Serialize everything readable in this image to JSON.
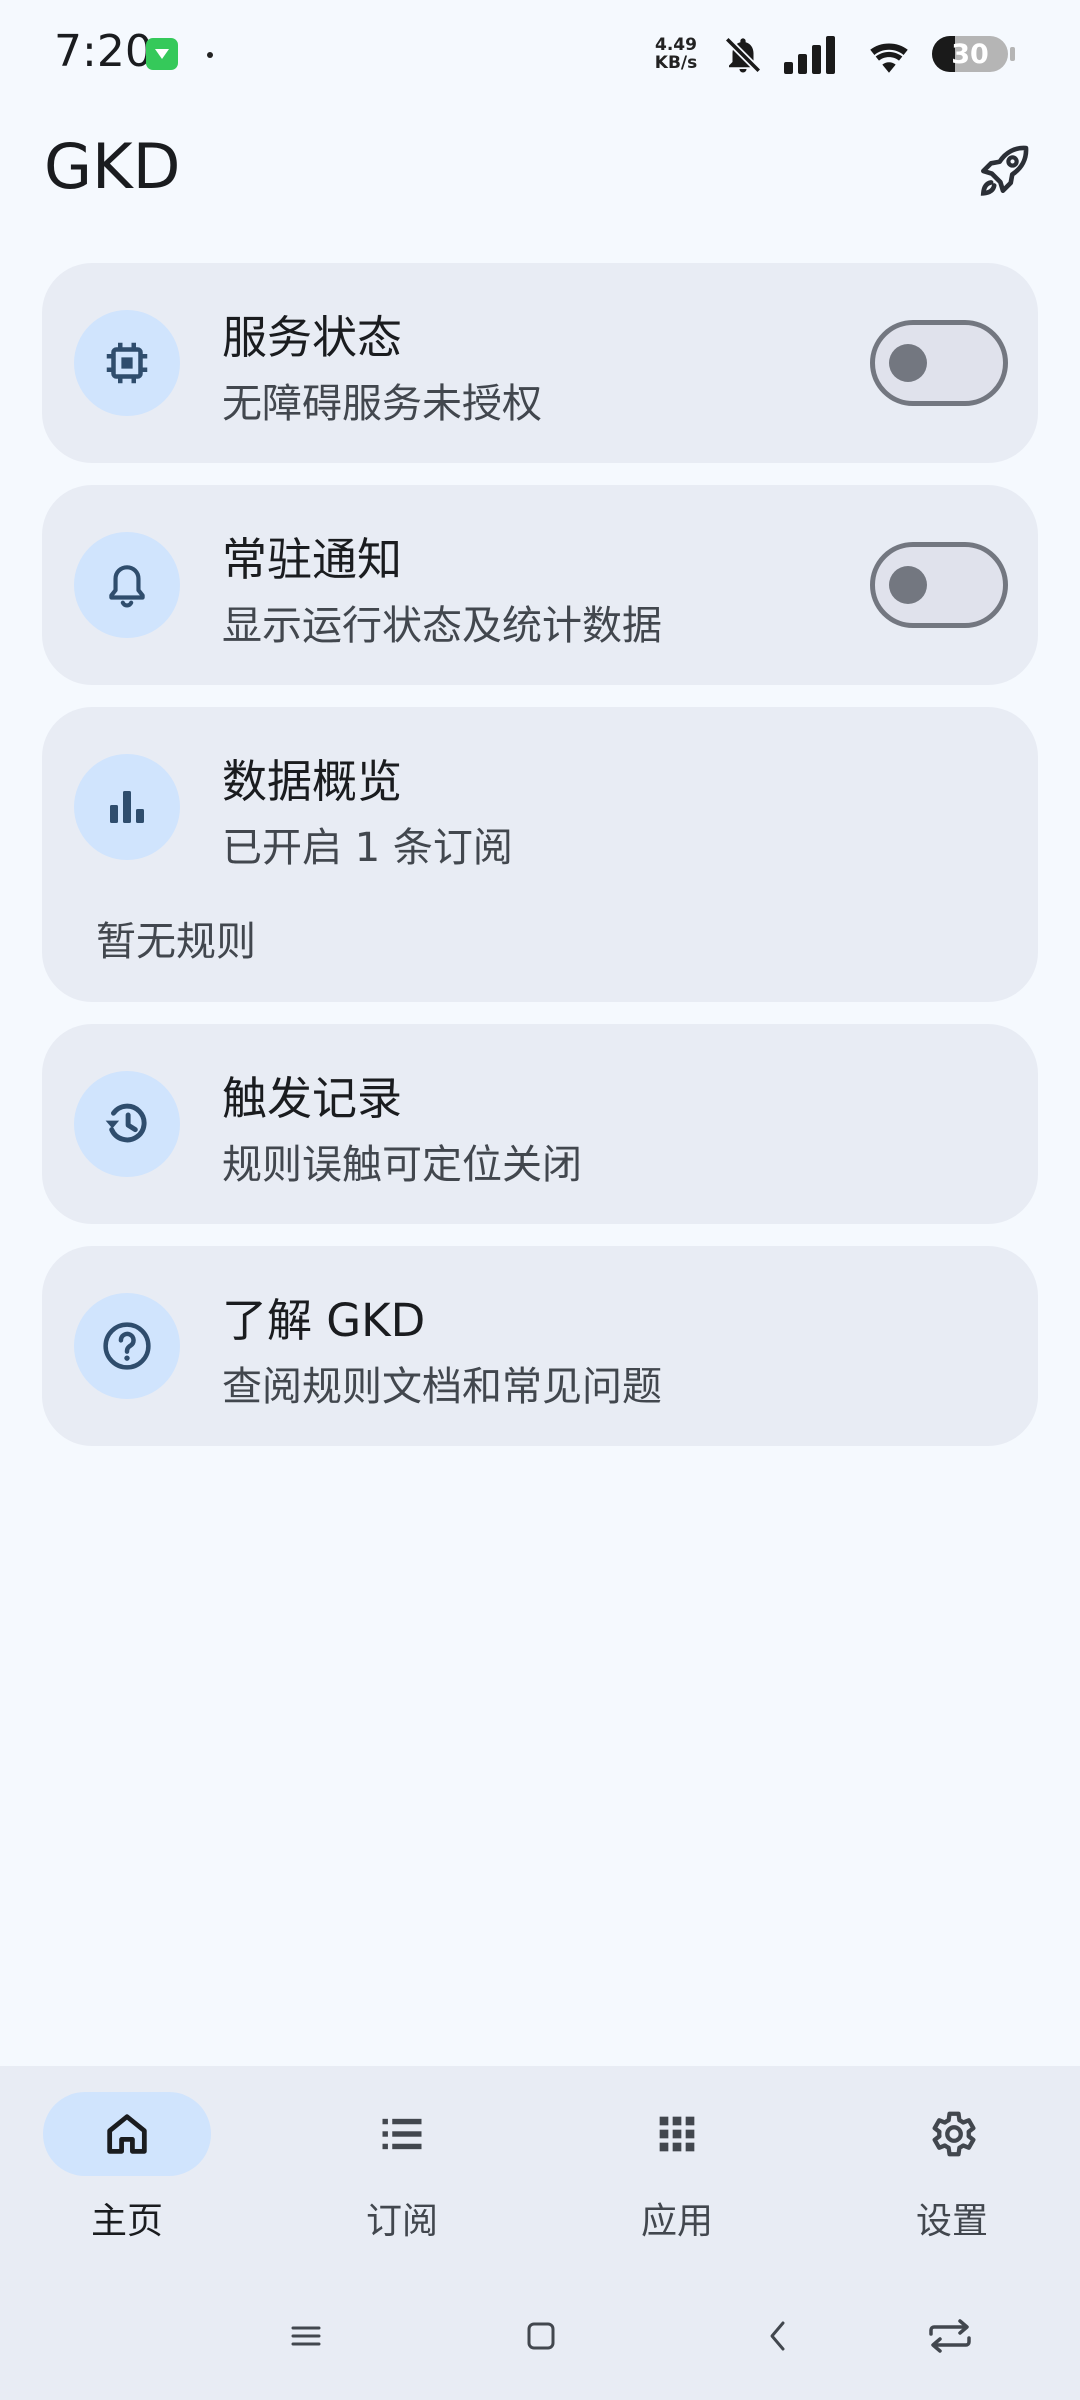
{
  "status_bar": {
    "time": "7:20",
    "net_speed_value": "4.49",
    "net_speed_unit": "KB/s",
    "battery": "30",
    "battery_level": 0.3
  },
  "app_bar": {
    "title": "GKD"
  },
  "cards": {
    "service": {
      "title": "服务状态",
      "subtitle": "无障碍服务未授权",
      "toggle_on": false
    },
    "notification": {
      "title": "常驻通知",
      "subtitle": "显示运行状态及统计数据",
      "toggle_on": false
    },
    "overview": {
      "title": "数据概览",
      "subtitle": "已开启 1 条订阅",
      "extra": "暂无规则"
    },
    "trigger_log": {
      "title": "触发记录",
      "subtitle": "规则误触可定位关闭"
    },
    "about": {
      "title": "了解 GKD",
      "subtitle": "查阅规则文档和常见问题"
    }
  },
  "bottom_nav": {
    "items": [
      {
        "label": "主页",
        "icon": "home-icon",
        "active": true
      },
      {
        "label": "订阅",
        "icon": "list-icon",
        "active": false
      },
      {
        "label": "应用",
        "icon": "apps-grid-icon",
        "active": false
      },
      {
        "label": "设置",
        "icon": "gear-icon",
        "active": false
      }
    ]
  },
  "colors": {
    "background": "#f5f9fe",
    "card": "#e8ecf4",
    "icon_container": "#d0e4fd",
    "icon": "#2f4d6d",
    "switch_off": "#737780"
  }
}
